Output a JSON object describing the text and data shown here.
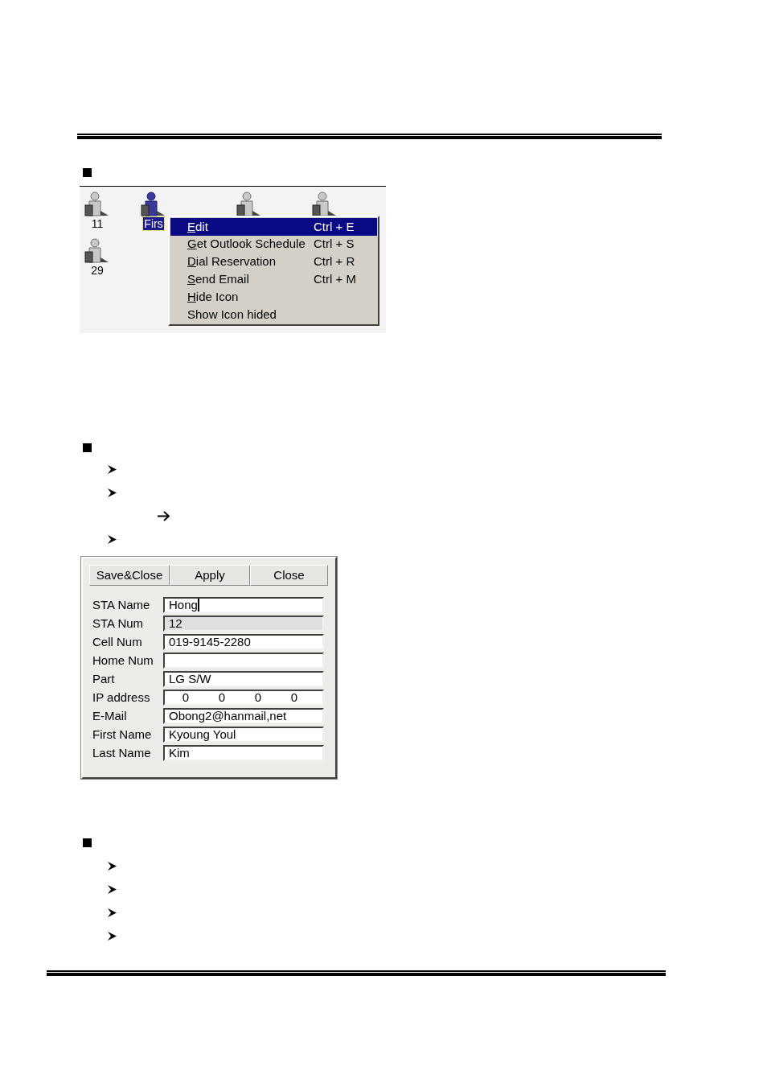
{
  "section_1": {
    "station_icons": [
      {
        "label": "11",
        "selected": false
      },
      {
        "label": "Firs",
        "selected": true
      },
      {
        "selected": false
      },
      {
        "selected": false
      },
      {
        "label": "29",
        "selected": false
      }
    ],
    "context_menu": [
      {
        "label": "Edit",
        "shortcut": "Ctrl + E",
        "underlined": true,
        "selected": true
      },
      {
        "label": "Get Outlook Schedule",
        "shortcut": "Ctrl + S",
        "underlined": true,
        "selected": false
      },
      {
        "label": "Dial Reservation",
        "shortcut": "Ctrl + R",
        "underlined": true,
        "selected": false
      },
      {
        "label": "Send Email",
        "shortcut": "Ctrl + M",
        "underlined": true,
        "selected": false
      },
      {
        "label": "Hide Icon",
        "underlined": true,
        "selected": false
      },
      {
        "label": "Show Icon hided",
        "underlined": false,
        "selected": false
      }
    ]
  },
  "section_2": {
    "bullets": [
      {
        "kind": "arrowhead"
      },
      {
        "kind": "arrowhead"
      },
      {
        "kind": "arrow"
      },
      {
        "kind": "arrowhead"
      }
    ],
    "dialog": {
      "buttons": [
        "Save&Close",
        "Apply",
        "Close"
      ],
      "fields": [
        {
          "label": "STA Name",
          "kind": "text",
          "value": "Hong",
          "focused": true,
          "disabled": false
        },
        {
          "label": "STA Num",
          "kind": "text",
          "value": "12",
          "focused": false,
          "disabled": true
        },
        {
          "label": "Cell Num",
          "kind": "text",
          "value": "019-9145-2280",
          "focused": false,
          "disabled": false
        },
        {
          "label": "Home Num",
          "kind": "text",
          "focused": false,
          "disabled": false
        },
        {
          "label": "Part",
          "kind": "text",
          "value": "LG S/W",
          "focused": false,
          "disabled": false
        },
        {
          "label": "IP address",
          "kind": "ip",
          "parts": [
            "0",
            "0",
            "0",
            "0"
          ],
          "focused": false,
          "disabled": false
        },
        {
          "label": "E-Mail",
          "kind": "text",
          "value": "Obong2@hanmail,net",
          "focused": false,
          "disabled": false
        },
        {
          "label": "First Name",
          "kind": "text",
          "value": "Kyoung Youl",
          "focused": false,
          "disabled": false
        },
        {
          "label": "Last Name",
          "kind": "text",
          "value": "Kim",
          "focused": false,
          "disabled": false
        }
      ]
    }
  },
  "section_3": {
    "bullets": [
      {
        "kind": "arrowhead"
      },
      {
        "kind": "arrowhead"
      },
      {
        "kind": "arrowhead"
      },
      {
        "kind": "arrowhead"
      }
    ]
  }
}
